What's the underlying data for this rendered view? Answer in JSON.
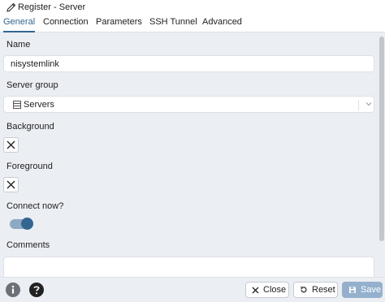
{
  "window": {
    "title": "Register - Server"
  },
  "tabs": [
    {
      "label": "General",
      "active": true
    },
    {
      "label": "Connection",
      "active": false
    },
    {
      "label": "Parameters",
      "active": false
    },
    {
      "label": "SSH Tunnel",
      "active": false
    },
    {
      "label": "Advanced",
      "active": false
    }
  ],
  "form": {
    "name": {
      "label": "Name",
      "value": "nisystemlink"
    },
    "server_group": {
      "label": "Server group",
      "value": "Servers"
    },
    "background": {
      "label": "Background"
    },
    "foreground": {
      "label": "Foreground"
    },
    "connect_now": {
      "label": "Connect now?",
      "value": true
    },
    "comments": {
      "label": "Comments",
      "value": ""
    }
  },
  "footer": {
    "info_icon": "info-icon",
    "help_icon": "help-icon",
    "close_label": "Close",
    "reset_label": "Reset",
    "save_label": "Save"
  },
  "colors": {
    "accent": "#326690",
    "toggle_track": "#8fa8c4",
    "save_disabled": "#94b0cc",
    "panel_bg": "#ebeef3"
  }
}
